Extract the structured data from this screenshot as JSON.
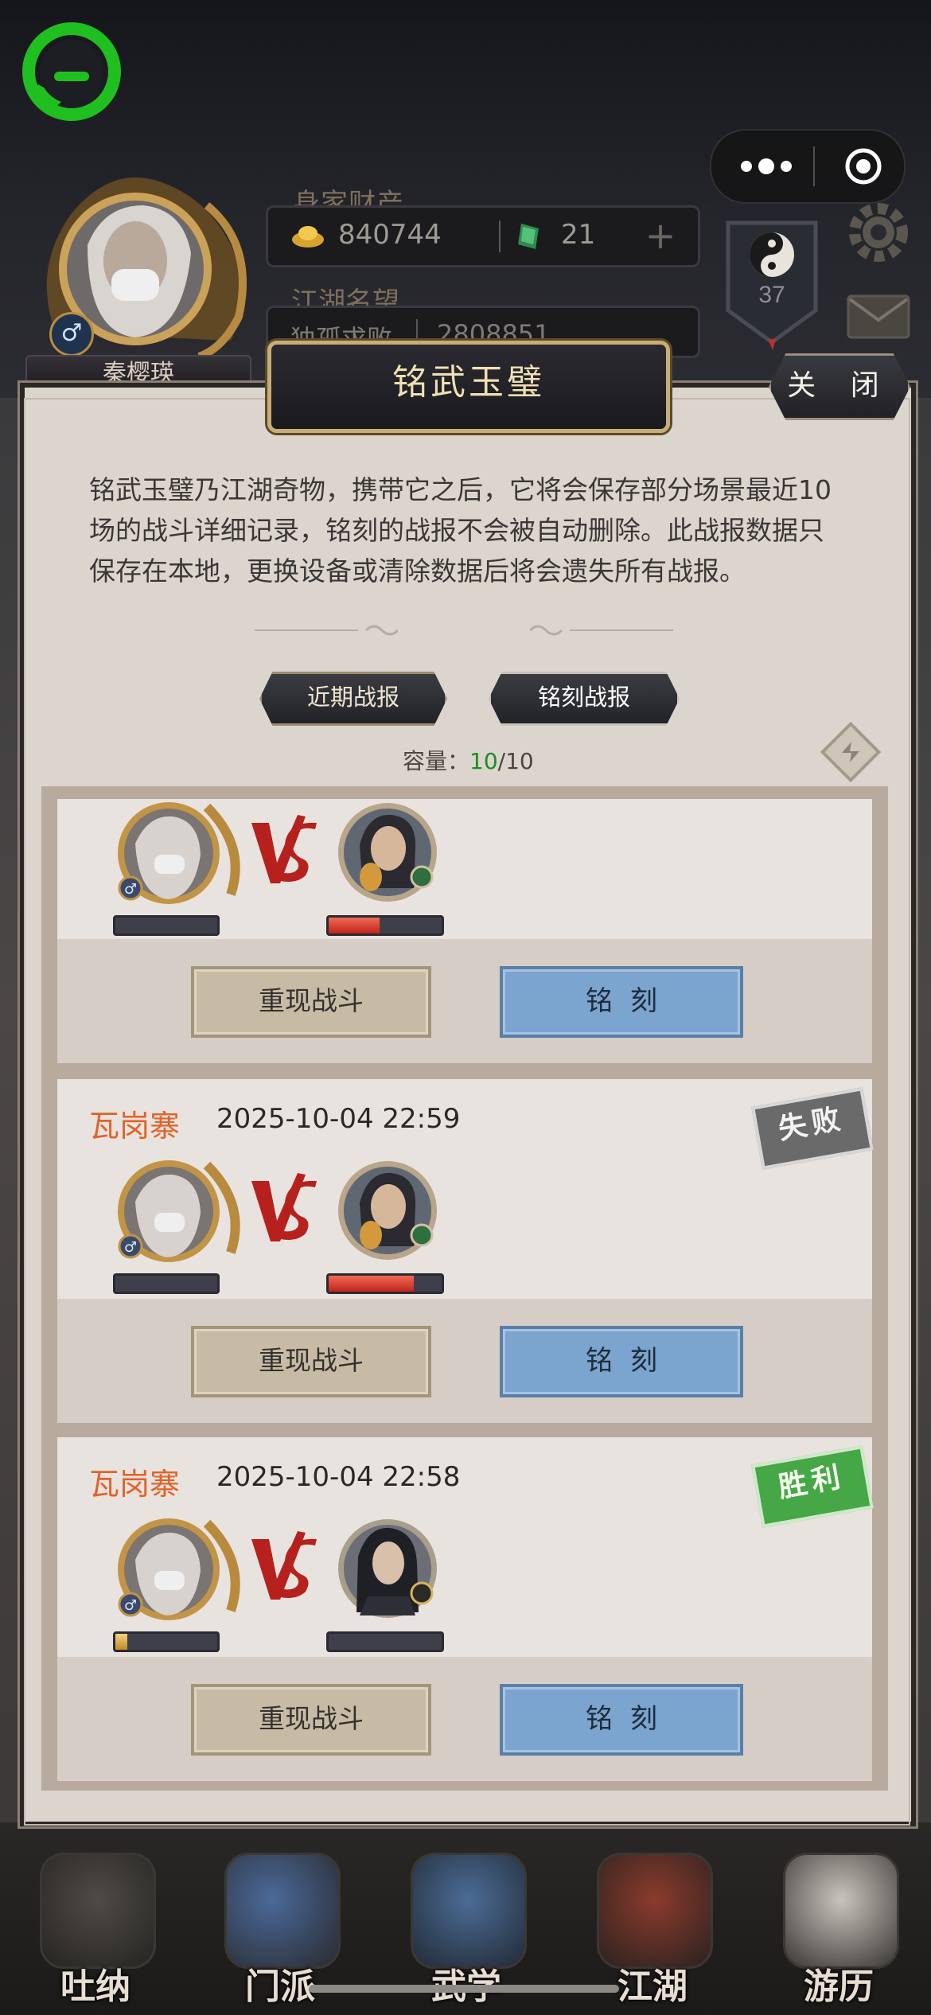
{
  "player": {
    "name": "秦樱瑛",
    "wealth_label": "身家财产",
    "gold": "840744",
    "jade": "21",
    "fame_label": "江湖名望",
    "fame_title": "独孤求败",
    "fame_value": "2808851",
    "rank_level": "37"
  },
  "dialog": {
    "title": "铭武玉璧",
    "close_label": "关 闭",
    "description": "铭武玉璧乃江湖奇物，携带它之后，它将会保存部分场景最近10场的战斗详细记录，铭刻的战报不会被自动删除。此战报数据只保存在本地，更换设备或清除数据后将会遗失所有战报。",
    "tabs": [
      {
        "label": "近期战报",
        "active": true
      },
      {
        "label": "铭刻战报",
        "active": false
      }
    ],
    "capacity_label": "容量：",
    "capacity_used": "10",
    "capacity_total": "/10"
  },
  "battles": [
    {
      "location": "",
      "datetime": "",
      "player_hp": 0,
      "enemy_hp": 0.45,
      "enemy_badge": "green",
      "replay_label": "重现战斗",
      "engrave_label": "铭刻"
    },
    {
      "location": "瓦岗寨",
      "datetime": "2025-10-04 22:59",
      "result": "失败",
      "player_hp": 0,
      "enemy_hp": 0.75,
      "enemy_badge": "green",
      "replay_label": "重现战斗",
      "engrave_label": "铭刻"
    },
    {
      "location": "瓦岗寨",
      "datetime": "2025-10-04 22:58",
      "result": "胜利",
      "player_hp": 0.12,
      "enemy_hp": 0,
      "enemy_badge": "gold",
      "replay_label": "重现战斗",
      "engrave_label": "铭刻"
    }
  ],
  "bottom_nav": [
    {
      "label": "吐纳",
      "icon": "meditation-icon"
    },
    {
      "label": "门派",
      "icon": "sect-icon"
    },
    {
      "label": "武学",
      "icon": "martial-book-icon"
    },
    {
      "label": "江湖",
      "icon": "jianghu-hat-icon"
    },
    {
      "label": "游历",
      "icon": "horse-icon"
    }
  ],
  "colors": {
    "win": "#45a746",
    "lose": "#6a6a6a",
    "location": "#e06329",
    "capacity_used": "#1e8d23",
    "engrave_button": "#7ba4cf"
  }
}
